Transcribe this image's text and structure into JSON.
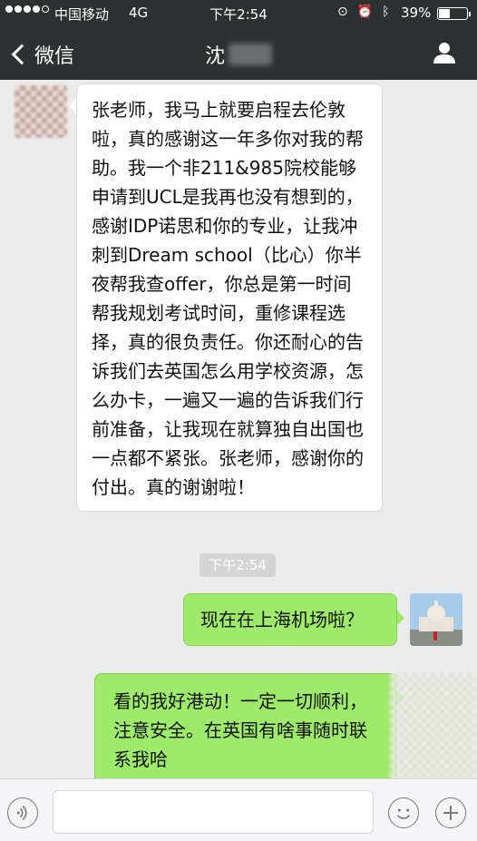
{
  "status_bar": {
    "carrier": "中国移动",
    "network": "4G",
    "time": "下午2:54",
    "battery_percent": "39%",
    "battery_level": 0.39
  },
  "nav": {
    "back_label": "微信",
    "contact_name": "沈"
  },
  "messages": {
    "incoming_1": "张老师，我马上就要启程去伦敦啦，真的感谢这一年多你对我的帮助。我一个非211&985院校能够申请到UCL是我再也没有想到的，感谢IDP诺思和你的专业，让我冲刺到Dream school（比心）你半夜帮我查offer，你总是第一时间帮我规划考试时间，重修课程选择，真的很负责任。你还耐心的告诉我们去英国怎么用学校资源，怎么办卡，一遍又一遍的告诉我们行前准备，让我现在就算独自出国也一点都不紧张。张老师，感谢你的付出。真的谢谢啦！",
    "timestamp": "下午2:54",
    "outgoing_1": "现在在上海机场啦？",
    "outgoing_2": "看的我好港动！一定一切顺利，注意安全。在英国有啥事随时联系我哈"
  },
  "icons": {
    "back": "chevron-left-icon",
    "profile": "person-icon",
    "voice": "voice-icon",
    "emoji": "emoji-icon",
    "plus": "plus-icon"
  },
  "colors": {
    "bar": "#2e3132",
    "outgoing_bubble": "#9eea6a",
    "incoming_bubble": "#ffffff",
    "background": "#ebebeb"
  }
}
